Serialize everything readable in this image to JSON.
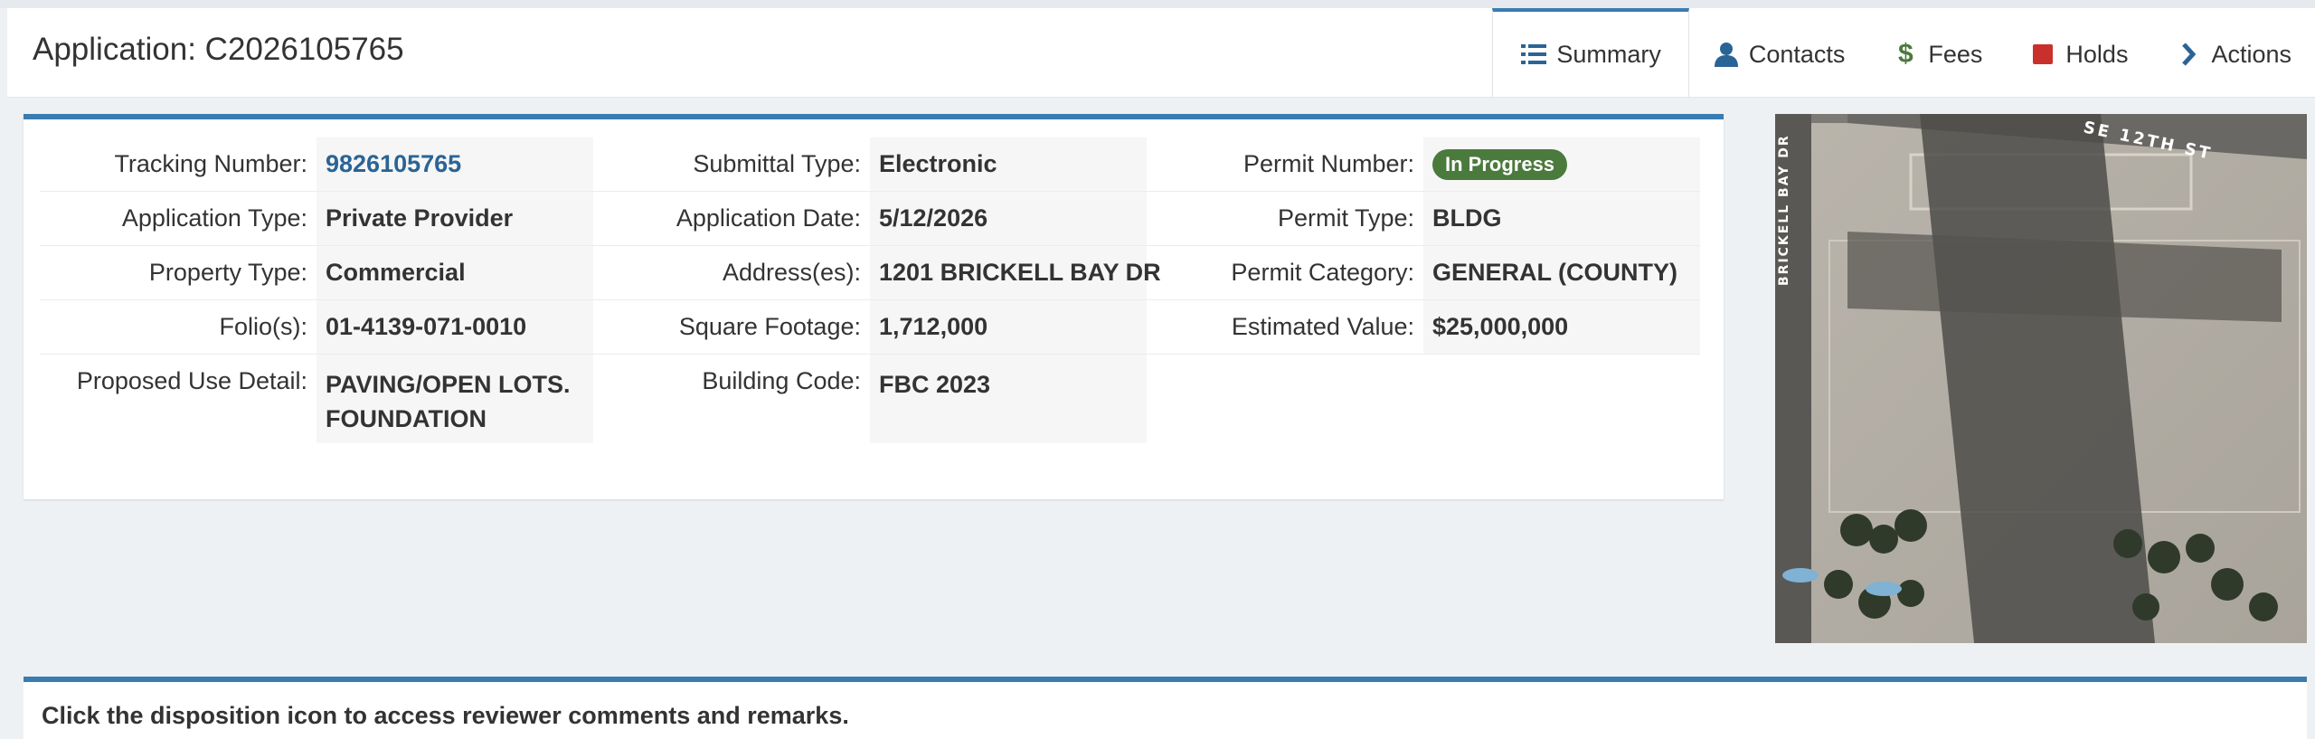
{
  "header": {
    "title": "Application: C2026105765",
    "tabs": [
      {
        "label": "Summary",
        "icon": "list-icon",
        "active": true
      },
      {
        "label": "Contacts",
        "icon": "user-icon"
      },
      {
        "label": "Fees",
        "icon": "dollar-icon"
      },
      {
        "label": "Holds",
        "icon": "square-icon"
      },
      {
        "label": "Actions",
        "icon": "chevron-right-icon"
      }
    ]
  },
  "details": {
    "tracking_number_label": "Tracking Number:",
    "tracking_number": "9826105765",
    "submittal_type_label": "Submittal Type:",
    "submittal_type": "Electronic",
    "permit_number_label": "Permit Number:",
    "permit_status": "In Progress",
    "application_type_label": "Application Type:",
    "application_type": "Private Provider",
    "application_date_label": "Application Date:",
    "application_date": "5/12/2026",
    "permit_type_label": "Permit Type:",
    "permit_type": "BLDG",
    "property_type_label": "Property Type:",
    "property_type": "Commercial",
    "addresses_label": "Address(es):",
    "addresses": "1201 BRICKELL BAY DR",
    "permit_category_label": "Permit Category:",
    "permit_category": "GENERAL (COUNTY)",
    "folios_label": "Folio(s):",
    "folios": "01-4139-071-0010",
    "square_footage_label": "Square Footage:",
    "square_footage": "1,712,000",
    "estimated_value_label": "Estimated Value:",
    "estimated_value": "$25,000,000",
    "proposed_use_label": "Proposed Use Detail:",
    "proposed_use": "PAVING/OPEN LOTS. FOUNDATION",
    "building_code_label": "Building Code:",
    "building_code": "FBC 2023"
  },
  "map": {
    "street_top": "SE 12TH ST",
    "street_left": "BRICKELL BAY DR"
  },
  "footer": {
    "instruction": "Click the disposition icon to access reviewer comments and remarks."
  },
  "colors": {
    "accent": "#3a7cb0",
    "link": "#2a6496",
    "status_badge": "#4b7a3d"
  }
}
